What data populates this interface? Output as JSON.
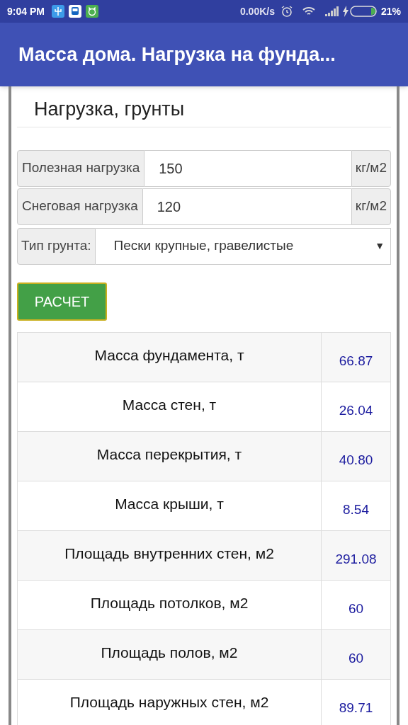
{
  "status_bar": {
    "time": "9:04 PM",
    "network_speed": "0.00K/s",
    "battery_percent": "21%"
  },
  "app_bar": {
    "title": "Масса дома. Нагрузка на фунда..."
  },
  "section_title": "Нагрузка, грунты",
  "fields": [
    {
      "label": "Полезная нагрузка",
      "value": "150",
      "unit": "кг/м2"
    },
    {
      "label": "Снеговая нагрузка",
      "value": "120",
      "unit": "кг/м2"
    }
  ],
  "soil_select": {
    "label": "Тип грунта:",
    "value": "Пески крупные, гравелистые",
    "arrow": "▼"
  },
  "calculate_button": "РАСЧЕТ",
  "results": [
    {
      "label": "Масса фундамента, т",
      "value": "66.87"
    },
    {
      "label": "Масса стен, т",
      "value": "26.04"
    },
    {
      "label": "Масса перекрытия, т",
      "value": "40.80"
    },
    {
      "label": "Масса крыши, т",
      "value": "8.54"
    },
    {
      "label": "Площадь внутренних стен, м2",
      "value": "291.08"
    },
    {
      "label": "Площадь потолков, м2",
      "value": "60"
    },
    {
      "label": "Площадь полов, м2",
      "value": "60"
    },
    {
      "label": "Площадь наружных стен, м2",
      "value": "89.71"
    }
  ]
}
